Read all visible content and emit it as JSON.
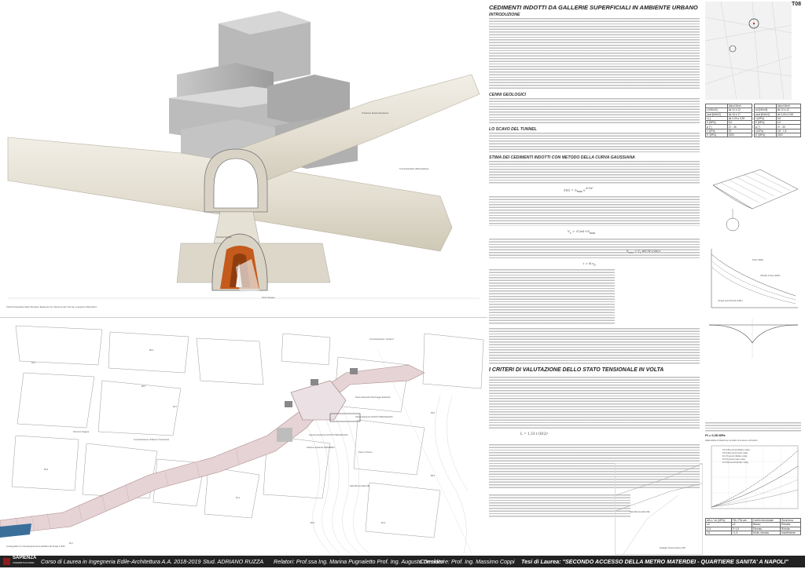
{
  "page_number": "T08",
  "render": {
    "caption": "Vista Prospettica delle Strutture Esistenti con Sezione del Tunnel e rapporto Altimetrico",
    "labels": [
      "Tubazione Strada Napoletana",
      "Tunnel Sanfelice (Metropolitana)",
      "Piazzale Spagna",
      "Punto Spagna"
    ]
  },
  "plan": {
    "labels": [
      "Percorso Spagna",
      "Tunnel Esistente di Bianco Condominio",
      "Tunnel Esistente \"Condò 2\"",
      "Ingresso Esistente NUOVO PARCHEGGIO",
      "Spazio Esistente NUOVO PARCHEGGIO",
      "Nuovo Raccordo Parcheggio Esistente",
      "Stazione Esistente MATERDEI",
      "Parco di Scavo",
      "Sala Mensa della Villa"
    ],
    "caption": "Cartografia con Sovrapposizione Edilizia all Scala 1:500",
    "caption_small": "Dettaglio Pianta",
    "scale_small": "Scala 1:250",
    "levels": [
      "92,3",
      "88,4",
      "86,5",
      "84,7",
      "82,9",
      "82,7",
      "81,1",
      "80,5",
      "82,3",
      "88,5",
      "84,5"
    ]
  },
  "text": {
    "title": "CEDIMENTI INDOTTI DA GALLERIE SUPERFICIALI IN AMBIENTE URBANO",
    "sections": [
      {
        "heading": "INTRODUZIONE",
        "size": "sub"
      },
      {
        "heading": "CENNI GEOLOGICI",
        "size": "sub"
      },
      {
        "heading": "LO SCAVO DEL TUNNEL",
        "size": "sub"
      },
      {
        "heading": "STIMA DEI CEDIMENTI INDOTTI CON METODO DELLA CURVA GAUSSIANA",
        "size": "sub"
      },
      {
        "heading": "I CRITERI DI VALUTAZIONE DELLO STATO TENSIONALE IN VOLTA",
        "size": "main"
      }
    ]
  },
  "right_col": {
    "params_table1": {
      "headers": [
        "",
        "Valori Medi"
      ],
      "rows": [
        [
          "γ [kN/m3]",
          "da 12 a 12"
        ],
        [
          "γsat [kN/m3]",
          "da 16 a 17"
        ],
        [
          "ν [-]",
          "da 0,25 a 0,35"
        ],
        [
          "E [MPa]",
          "5,0"
        ],
        [
          "ϕ' [°]",
          "27 - 35"
        ],
        [
          "c' [kPa]",
          "15"
        ],
        [
          "E' [MPa]",
          "1500"
        ]
      ]
    },
    "params_table2": {
      "headers": [
        "",
        "Valori Medi"
      ],
      "rows": [
        [
          "γd [kN/m3]",
          "da 12 a 12"
        ],
        [
          "γsat [kN/m3]",
          "da 0,45 a 0,55"
        ],
        [
          "ν [MPa]",
          "3,6"
        ],
        [
          "E [MPa]",
          "4,0"
        ],
        [
          "ϕ [°]",
          "27 - 39"
        ],
        [
          "c [kPa]",
          "0,8 - 1,8"
        ],
        [
          "E' [MPa]",
          "2300"
        ]
      ]
    },
    "graph1_legend": [
      "Peck (1969)",
      "O'Reilly & New (1982)",
      "Clough and Schmidt (1981)"
    ],
    "stress_table": {
      "headers": [
        "σθ,c / σc (MPa)",
        "Ftb / Ftb,am",
        "Livello tensionale",
        "Sicurezza"
      ],
      "rows": [
        [
          "≤2",
          "≤3",
          "Basso",
          "Elevata"
        ],
        [
          "2-3",
          "3÷1,5",
          "Elevato",
          "Ridotta"
        ],
        [
          ">3",
          "<1,5",
          "Molto elevato",
          "Insufficiente"
        ]
      ]
    },
    "fs_note": "Ft = 0,35 MPa",
    "graph2_title": "Dalla tabella di Relazione tra livello di tensione e Rinnalzo",
    "graph2_legend": [
      "FS=0,5/4 piccoli (Reflex volta)",
      "FS=0,5/4 piccoli (solo volta)",
      "Ft=0,5 piccoli (Reflex volta)",
      "Ft=0,5 piccoli (solo volta)",
      "Ft=0,50 piccoli (Reflex volta)"
    ]
  },
  "footer": {
    "university": "SAPIENZA",
    "university_sub": "UNIVERSITÀ DI ROMA",
    "course": "Corso di Laurea in Ingegneria Edile-Architettura  A.A. 2018-2019",
    "student": "Stud. ADRIANO RUZZA",
    "advisors": "Relatori:   Prof.ssa Ing. Marina Pugnaletto   Prof. Ing. Augusto Desideri",
    "coadvisor": "Correlatore: Prof. Ing. Massimo Coppi",
    "thesis": "Tesi di Laurea: \"SECONDO ACCESSO DELLA METRO MATERDEI - QUARTIERE SANITA' A NAPOLI\""
  }
}
